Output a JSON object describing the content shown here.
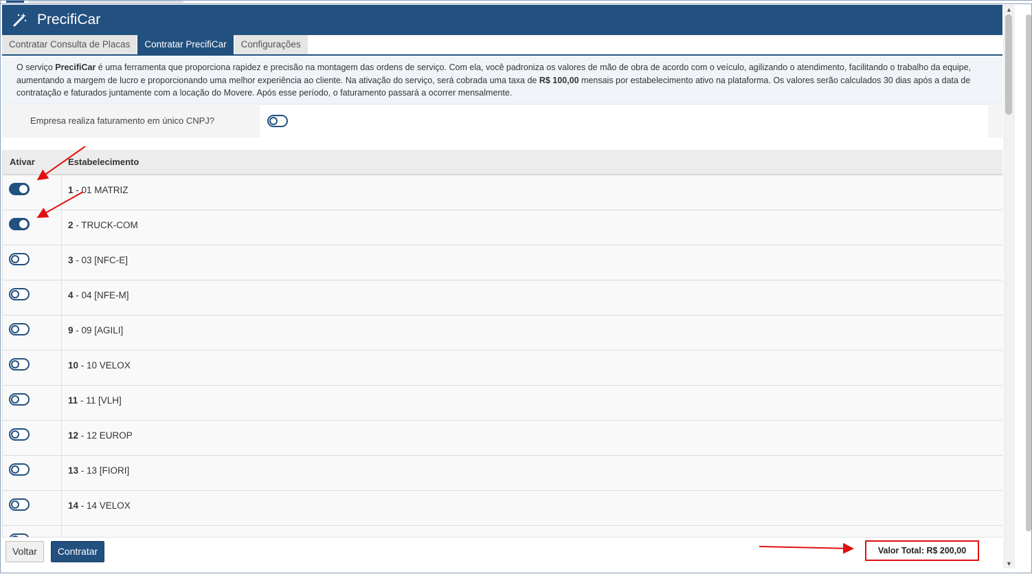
{
  "app": {
    "title": "PrecifiCar",
    "icon": "magic-wand-icon"
  },
  "tabs": [
    {
      "label": "Contratar Consulta de Placas",
      "active": false
    },
    {
      "label": "Contratar PrecifiCar",
      "active": true
    },
    {
      "label": "Configurações",
      "active": false
    }
  ],
  "info": {
    "p1": "O serviço ",
    "brand": "PrecifiCar",
    "p2": " é uma ferramenta que proporciona rapidez e precisão na montagem das ordens de serviço. Com ela, você padroniza os valores de mão de obra de acordo com o veículo, agilizando o atendimento, facilitando o trabalho da equipe, aumentando a margem de lucro e proporcionando uma melhor experiência ao cliente. Na ativação do serviço, será cobrada uma taxa de ",
    "price": "R$ 100,00",
    "p3": " mensais por estabelecimento ativo na plataforma. Os valores serão calculados 30 dias após a data de contratação e faturados juntamente com a locação do Movere. Após esse período, o faturamento passará a ocorrer mensalmente."
  },
  "cnpj": {
    "label": "Empresa realiza faturamento em único CNPJ?",
    "enabled": false
  },
  "table": {
    "col_ativar": "Ativar",
    "col_estab": "Estabelecimento",
    "rows": [
      {
        "code": "1",
        "name": " - 01 MATRIZ",
        "active": true
      },
      {
        "code": "2",
        "name": " - TRUCK-COM",
        "active": true
      },
      {
        "code": "3",
        "name": " - 03 [NFC-E]",
        "active": false
      },
      {
        "code": "4",
        "name": " - 04 [NFE-M]",
        "active": false
      },
      {
        "code": "9",
        "name": " - 09 [AGILI]",
        "active": false
      },
      {
        "code": "10",
        "name": " - 10 VELOX",
        "active": false
      },
      {
        "code": "11",
        "name": " - 11 [VLH]",
        "active": false
      },
      {
        "code": "12",
        "name": " - 12 EUROP",
        "active": false
      },
      {
        "code": "13",
        "name": " - 13 [FIORI]",
        "active": false
      },
      {
        "code": "14",
        "name": " - 14 VELOX",
        "active": false
      },
      {
        "code": "",
        "name": "",
        "active": false
      }
    ]
  },
  "footer": {
    "back_label": "Voltar",
    "contract_label": "Contratar",
    "total": "Valor Total: R$ 200,00"
  },
  "colors": {
    "primary": "#22507f",
    "annotation": "#e01010"
  }
}
